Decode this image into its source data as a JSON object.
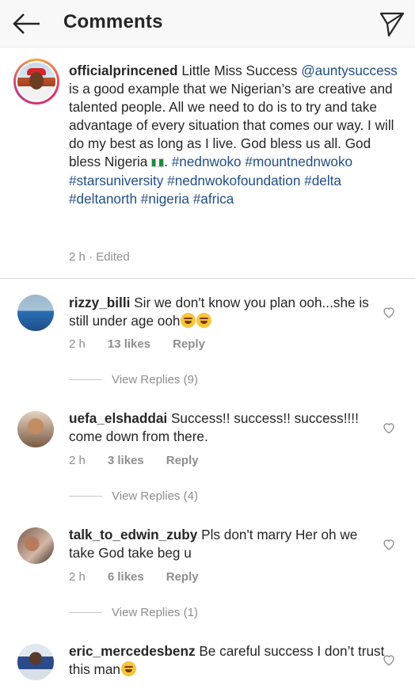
{
  "header": {
    "title": "Comments",
    "back_icon": "arrow-left-icon",
    "send_icon": "paper-plane-icon"
  },
  "caption": {
    "username": "officialprincened",
    "text_1": "Little Miss Success",
    "mention": "@auntysuccess",
    "text_2": "is a good example that we Nigerian’s are creative and talented people. All we need to do is to try and take advantage of every situation that comes our way. I will do my best as long as I live. God bless us all. God bless Nigeria",
    "hashtags_1": "#nednwoko",
    "hashtags_2": "#mountnednwoko #starsuniversity #nednwokofoundation #delta #deltanorth #nigeria #africa",
    "time": "2 h",
    "edited": "· Edited"
  },
  "comments": [
    {
      "username": "rizzy_billi",
      "text": "Sir we don't know you plan ooh...she is still under age ooh",
      "emoji_count": 2,
      "time": "2 h",
      "likes": "13 likes",
      "reply": "Reply",
      "view_replies": "View Replies (9)"
    },
    {
      "username": "uefa_elshaddai",
      "text": "Success!! success!! success!!!! come down from there.",
      "time": "2 h",
      "likes": "3 likes",
      "reply": "Reply",
      "view_replies": "View Replies (4)"
    },
    {
      "username": "talk_to_edwin_zuby",
      "text": "Pls don't marry Her oh we take God take beg u",
      "time": "2 h",
      "likes": "6 likes",
      "reply": "Reply",
      "view_replies": "View Replies (1)"
    },
    {
      "username": "eric_mercedesbenz",
      "text": "Be careful success I don’t trust this man",
      "emoji_count": 1
    }
  ],
  "colors": {
    "link": "#1f4e8c",
    "meta_gray": "#8e8e8e",
    "text": "#262626"
  }
}
